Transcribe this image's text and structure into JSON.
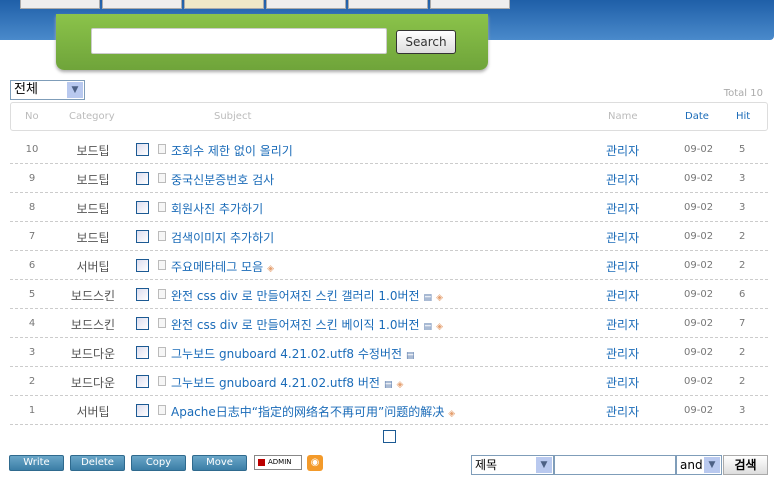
{
  "search": {
    "button": "Search",
    "value": ""
  },
  "category_select": "전체",
  "total": "Total 10",
  "headers": {
    "no": "No",
    "category": "Category",
    "subject": "Subject",
    "name": "Name",
    "date": "Date",
    "hit": "Hit"
  },
  "rows": [
    {
      "no": "10",
      "category": "보드팁",
      "subject": "조회수 제한 없이 올리기",
      "file": false,
      "tag": false,
      "name": "관리자",
      "date": "09-02",
      "hit": "5"
    },
    {
      "no": "9",
      "category": "보드팁",
      "subject": "중국신분증번호 검사",
      "file": false,
      "tag": false,
      "name": "관리자",
      "date": "09-02",
      "hit": "3"
    },
    {
      "no": "8",
      "category": "보드팁",
      "subject": "회원사진 추가하기",
      "file": false,
      "tag": false,
      "name": "관리자",
      "date": "09-02",
      "hit": "3"
    },
    {
      "no": "7",
      "category": "보드팁",
      "subject": "검색이미지 추가하기",
      "file": false,
      "tag": false,
      "name": "관리자",
      "date": "09-02",
      "hit": "2"
    },
    {
      "no": "6",
      "category": "서버팁",
      "subject": "주요메타테그 모음",
      "file": false,
      "tag": true,
      "name": "관리자",
      "date": "09-02",
      "hit": "2"
    },
    {
      "no": "5",
      "category": "보드스킨",
      "subject": "완전 css div 로 만들어져진 스킨 갤러리 1.0버전",
      "file": true,
      "tag": true,
      "name": "관리자",
      "date": "09-02",
      "hit": "6"
    },
    {
      "no": "4",
      "category": "보드스킨",
      "subject": "완전 css div 로 만들어져진 스킨 베이직 1.0버전",
      "file": true,
      "tag": true,
      "name": "관리자",
      "date": "09-02",
      "hit": "7"
    },
    {
      "no": "3",
      "category": "보드다운",
      "subject": "그누보드 gnuboard 4.21.02.utf8 수정버전",
      "file": true,
      "tag": false,
      "name": "관리자",
      "date": "09-02",
      "hit": "2"
    },
    {
      "no": "2",
      "category": "보드다운",
      "subject": "그누보드 gnuboard 4.21.02.utf8 버전",
      "file": true,
      "tag": true,
      "name": "관리자",
      "date": "09-02",
      "hit": "2"
    },
    {
      "no": "1",
      "category": "서버팁",
      "subject": "Apache日志中“指定的网络名不再可用”问题的解决",
      "file": false,
      "tag": true,
      "name": "관리자",
      "date": "09-02",
      "hit": "3"
    }
  ],
  "actions": {
    "write": "Write",
    "delete": "Delete",
    "copy": "Copy",
    "move": "Move",
    "admin": "ADMIN"
  },
  "footer_search": {
    "field": "제목",
    "value": "",
    "operator": "and",
    "button": "검색"
  }
}
